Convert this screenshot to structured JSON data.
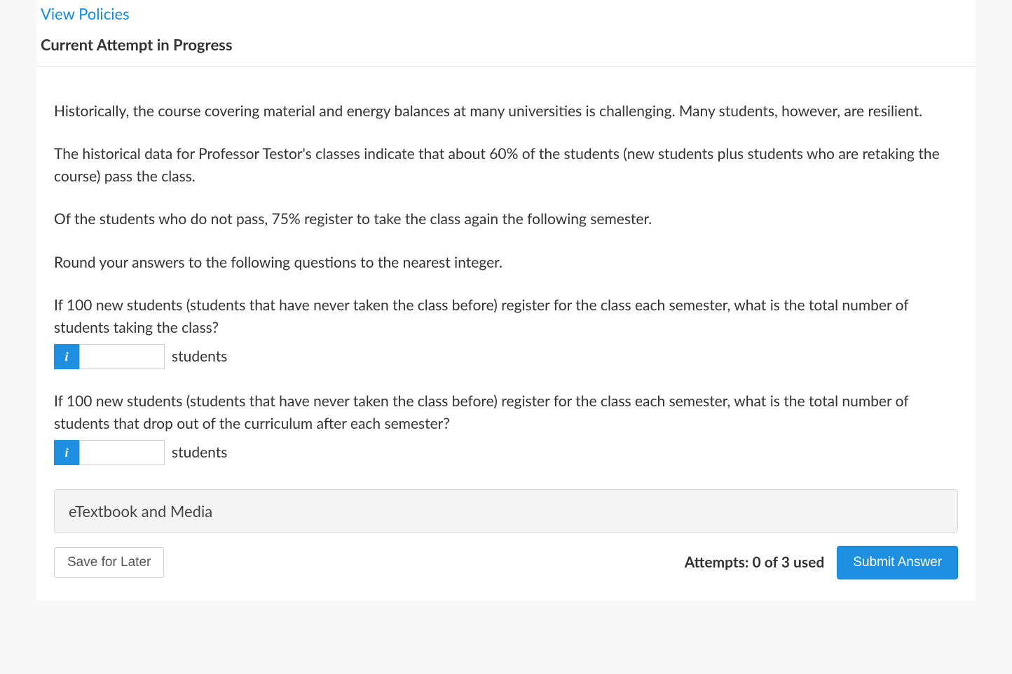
{
  "header": {
    "policies_link": "View Policies",
    "attempt_status": "Current Attempt in Progress"
  },
  "question": {
    "paragraph1": "Historically, the course covering material and energy balances at many universities is challenging. Many students, however, are resilient.",
    "paragraph2": "The historical data for Professor Testor's classes indicate that about 60% of the students (new students plus students who are retaking the course) pass the class.",
    "paragraph3": "Of the students who do not pass, 75% register to take the class again the following semester.",
    "paragraph4": "Round your answers to the following questions to the nearest integer.",
    "prompt1": "If 100 new students (students that have never taken the class before) register for the class each semester, what is the total number of students taking the class?",
    "prompt2": "If 100 new students (students that have never taken the class before) register for the class each semester, what is the total number of students that drop out of the curriculum after each semester?",
    "info_icon": "i",
    "unit_label": "students",
    "input1_value": "",
    "input2_value": ""
  },
  "resources": {
    "etextbook_label": "eTextbook and Media"
  },
  "footer": {
    "save_label": "Save for Later",
    "attempts_text": "Attempts: 0 of 3 used",
    "submit_label": "Submit Answer"
  }
}
